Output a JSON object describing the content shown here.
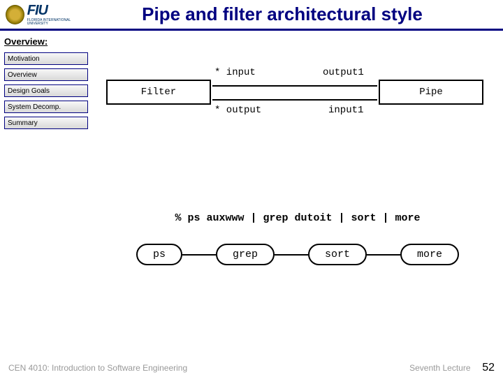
{
  "header": {
    "logo_main": "FIU",
    "logo_sub": "FLORIDA INTERNATIONAL UNIVERSITY",
    "title": "Pipe and filter architectural style"
  },
  "sidebar": {
    "section": "Overview:",
    "items": [
      {
        "label": "Motivation"
      },
      {
        "label": "Overview"
      },
      {
        "label": "Design Goals"
      },
      {
        "label": "System Decomp."
      },
      {
        "label": "Summary"
      }
    ]
  },
  "diagram": {
    "filter_label": "Filter",
    "pipe_label": "Pipe",
    "input_star": "* input",
    "output_star": "* output",
    "output1": "output1",
    "input1": "input1"
  },
  "command_line": "% ps auxwww | grep dutoit | sort | more",
  "pipeline": {
    "nodes": [
      "ps",
      "grep",
      "sort",
      "more"
    ]
  },
  "footer": {
    "left": "CEN 4010: Introduction to Software Engineering",
    "right": "Seventh Lecture",
    "page": "52"
  }
}
